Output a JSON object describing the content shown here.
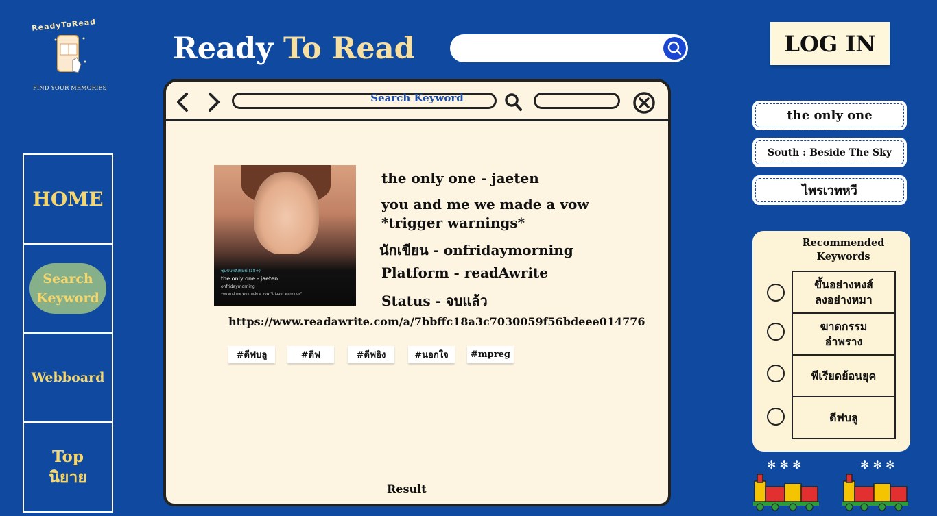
{
  "logo": {
    "top_text": "ReadyToRead",
    "bottom_text": "FIND YOUR MEMORIES"
  },
  "header": {
    "title_part1": "Ready ",
    "title_part2": "To Read",
    "search_value": "",
    "login_label": "LOG IN"
  },
  "sidebar": {
    "home": "HOME",
    "search": "Search Keyword",
    "webboard": "Webboard",
    "top_line1": "Top",
    "top_line2": "นิยาย"
  },
  "browser": {
    "address_text": "Search Keyword"
  },
  "cover": {
    "tag_line": "ชุมชนหลังพิมพ์ (18+)",
    "title": "the only one - jaeten",
    "author": "onfridaymorning",
    "desc": "you and me we made a vow *trigger warnings*"
  },
  "result": {
    "title": "the only one - jaeten",
    "desc_line1": "you and me we made a vow",
    "desc_line2": "*trigger warnings*",
    "author": "นักเขียน - onfridaymorning",
    "platform": "Platform - readAwrite",
    "status": "Status - จบแล้ว",
    "url": "https://www.readawrite.com/a/7bbffc18a3c7030059f56bdeee014776",
    "tags": [
      "#ดีฟบลู",
      "#ดีฟ",
      "#ดีฟอิง",
      "#นอกใจ",
      "#mpreg"
    ],
    "label": "Result"
  },
  "keywords": [
    "the only one",
    "South : Beside The Sky",
    "ไพรเวทหวี"
  ],
  "recommended": {
    "title_line1": "Recommended",
    "title_line2": "Keywords",
    "items": [
      {
        "line1": "ขึ้นอย่างหงส์",
        "line2": "ลงอย่างหมา"
      },
      {
        "line1": "ฆาตกรรม",
        "line2": "อำพราง"
      },
      {
        "line1": "พีเรียดย้อนยุค",
        "line2": ""
      },
      {
        "line1": "ดีฟบลู",
        "line2": ""
      }
    ]
  },
  "colors": {
    "background": "#0f4aa0",
    "accent_yellow": "#f6d56a",
    "cream": "#fdf4e2",
    "search_button": "#1947d3"
  }
}
